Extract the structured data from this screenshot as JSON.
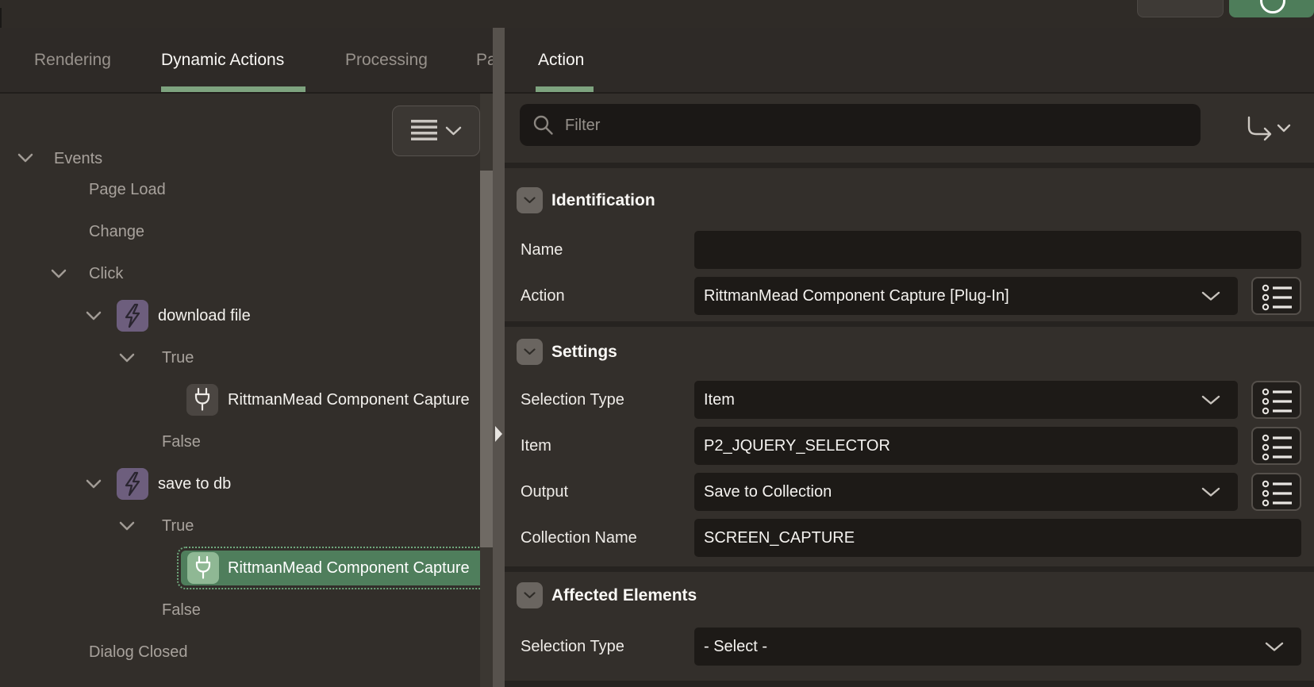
{
  "colors": {
    "accent_green": "#7EA37F",
    "selection_green": "#4F7E5C",
    "selection_icon_green": "#8FB894",
    "lightning_purple": "#6D5E7D",
    "panel_bg": "#322E2A",
    "input_bg": "#1D1A17",
    "splitter": "#57524D"
  },
  "top_bar": {
    "buttons": [
      {
        "name": "secondary-button",
        "label": ""
      },
      {
        "name": "primary-button",
        "label": "",
        "icon": "circle-glyph"
      }
    ]
  },
  "left_panel": {
    "tabs": [
      {
        "label": "Rendering",
        "active": false
      },
      {
        "label": "Dynamic Actions",
        "active": true
      },
      {
        "label": "Processing",
        "active": false
      },
      {
        "label": "Pa",
        "active": false,
        "clipped": true
      }
    ],
    "tree_header": {
      "label": "Events",
      "menu_icon": "list-menu-with-chevron"
    },
    "tree": [
      {
        "label": "Page Load",
        "level": 1,
        "kind": "event"
      },
      {
        "label": "Change",
        "level": 1,
        "kind": "event"
      },
      {
        "label": "Click",
        "level": 1,
        "kind": "event",
        "expanded": true
      },
      {
        "label": "download file",
        "level": 2,
        "kind": "dynamic-action",
        "icon": "lightning-icon",
        "expanded": true
      },
      {
        "label": "True",
        "level": 3,
        "kind": "branch",
        "expanded": true
      },
      {
        "label": "RittmanMead Component Capture",
        "level": 4,
        "kind": "plugin-action",
        "icon": "plug-icon",
        "selected": false
      },
      {
        "label": "False",
        "level": 3,
        "kind": "branch"
      },
      {
        "label": "save to db",
        "level": 2,
        "kind": "dynamic-action",
        "icon": "lightning-icon",
        "expanded": true
      },
      {
        "label": "True",
        "level": 3,
        "kind": "branch",
        "expanded": true
      },
      {
        "label": "RittmanMead Component Capture",
        "level": 4,
        "kind": "plugin-action",
        "icon": "plug-icon",
        "selected": true
      },
      {
        "label": "False",
        "level": 3,
        "kind": "branch"
      },
      {
        "label": "Dialog Closed",
        "level": 1,
        "kind": "event"
      }
    ]
  },
  "right_panel": {
    "tabs": [
      {
        "label": "Action",
        "active": true
      }
    ],
    "filter": {
      "placeholder": "Filter",
      "icons": [
        "search-icon",
        "goto-group-arrow-icon"
      ]
    },
    "sections": [
      {
        "title": "Identification",
        "fields": [
          {
            "label": "Name",
            "type": "text",
            "value": "",
            "full_width": true
          },
          {
            "label": "Action",
            "type": "select",
            "value": "RittmanMead Component Capture [Plug-In]",
            "has_lov": true
          }
        ]
      },
      {
        "title": "Settings",
        "fields": [
          {
            "label": "Selection Type",
            "type": "select",
            "value": "Item",
            "has_lov": true
          },
          {
            "label": "Item",
            "type": "text",
            "value": "P2_JQUERY_SELECTOR",
            "has_lov": true
          },
          {
            "label": "Output",
            "type": "select",
            "value": "Save to Collection",
            "has_lov": true
          },
          {
            "label": "Collection Name",
            "type": "text",
            "value": "SCREEN_CAPTURE",
            "full_width": true
          }
        ]
      },
      {
        "title": "Affected Elements",
        "fields": [
          {
            "label": "Selection Type",
            "type": "select",
            "value": "- Select -",
            "full_width": true
          }
        ]
      }
    ]
  }
}
